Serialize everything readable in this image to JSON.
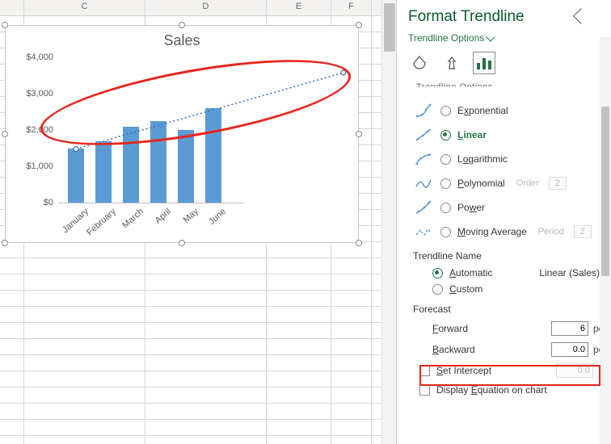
{
  "columns": [
    "C",
    "D",
    "E",
    "F"
  ],
  "chart_data": {
    "type": "bar",
    "title": "Sales",
    "categories": [
      "January",
      "February",
      "March",
      "April",
      "May",
      "June"
    ],
    "values": [
      1500,
      1700,
      2100,
      2250,
      2000,
      2600
    ],
    "ylabel": "",
    "xlabel": "",
    "ylim": [
      0,
      4000
    ],
    "yticks_labels": [
      "$0",
      "$1,000",
      "$2,000",
      "$3,000",
      "$4,000"
    ],
    "trendline": {
      "type": "Linear",
      "forecast_forward": 6.0,
      "projected_end_value_approx": 3600
    }
  },
  "pane": {
    "title": "Format Trendline",
    "sub": "Trendline Options",
    "section_trunc": "Trendline Options",
    "types": [
      {
        "key": "exponential",
        "label": "Exponential",
        "u": "x",
        "selected": false,
        "svg": "exp"
      },
      {
        "key": "linear",
        "label": "Linear",
        "u": "L",
        "selected": true,
        "svg": "lin"
      },
      {
        "key": "logarithmic",
        "label": "Logarithmic",
        "u": "O",
        "selected": false,
        "svg": "log"
      },
      {
        "key": "polynomial",
        "label": "Polynomial",
        "u": "P",
        "selected": false,
        "svg": "pol",
        "param_label": "Order",
        "param_val": "2"
      },
      {
        "key": "power",
        "label": "Power",
        "u": "W",
        "selected": false,
        "svg": "pow"
      },
      {
        "key": "movingavg",
        "label": "Moving Average",
        "u": "M",
        "selected": false,
        "svg": "mov",
        "param_label": "Period",
        "param_val": "2"
      }
    ],
    "name_section": "Trendline Name",
    "name_auto": "Automatic",
    "name_auto_val": "Linear (Sales)",
    "name_custom": "Custom",
    "forecast_section": "Forecast",
    "forward_lbl": "Forward",
    "forward_val": "6",
    "forward_unit": "periods",
    "backward_lbl": "Backward",
    "backward_val": "0.0",
    "backward_unit": "periods",
    "set_intercept": "Set Intercept",
    "set_intercept_val": "0.0",
    "disp_eq": "Display Equation on chart"
  }
}
